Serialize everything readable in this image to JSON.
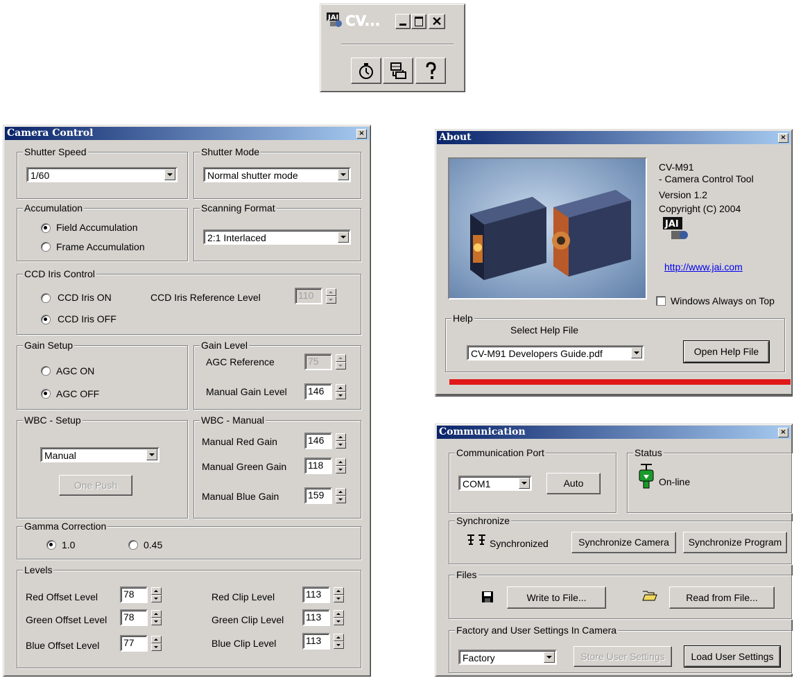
{
  "toolbar_window": {
    "title": "CV...",
    "buttons": [
      "minimize",
      "maximize",
      "close"
    ],
    "icons": [
      "stopwatch-icon",
      "network-icon",
      "help-icon"
    ]
  },
  "camera_control": {
    "title": "Camera Control",
    "close_glyph": "×",
    "shutter_speed": {
      "label": "Shutter Speed",
      "value": "1/60"
    },
    "shutter_mode": {
      "label": "Shutter Mode",
      "value": "Normal shutter mode"
    },
    "accumulation": {
      "label": "Accumulation",
      "options": [
        "Field Accumulation",
        "Frame Accumulation"
      ],
      "selected": 0
    },
    "scanning_format": {
      "label": "Scanning Format",
      "value": "2:1 Interlaced"
    },
    "ccd_iris": {
      "label": "CCD Iris Control",
      "options": [
        "CCD Iris ON",
        "CCD Iris OFF"
      ],
      "selected": 1,
      "ref_label": "CCD Iris Reference Level",
      "ref_value": "110"
    },
    "gain_setup": {
      "label": "Gain Setup",
      "options": [
        "AGC ON",
        "AGC OFF"
      ],
      "selected": 1
    },
    "gain_level": {
      "label": "Gain Level",
      "agc_ref_label": "AGC Reference",
      "agc_ref_value": "75",
      "manual_label": "Manual Gain Level",
      "manual_value": "146"
    },
    "wbc_setup": {
      "label": "WBC - Setup",
      "value": "Manual",
      "one_push": "One Push"
    },
    "wbc_manual": {
      "label": "WBC - Manual",
      "red_label": "Manual Red Gain",
      "red_value": "146",
      "green_label": "Manual Green Gain",
      "green_value": "118",
      "blue_label": "Manual Blue Gain",
      "blue_value": "159"
    },
    "gamma": {
      "label": "Gamma Correction",
      "options": [
        "1.0",
        "0.45"
      ],
      "selected": 0
    },
    "levels": {
      "label": "Levels",
      "red_offset_label": "Red Offset Level",
      "red_offset": "78",
      "green_offset_label": "Green Offset Level",
      "green_offset": "78",
      "blue_offset_label": "Blue Offset Level",
      "blue_offset": "77",
      "red_clip_label": "Red Clip Level",
      "red_clip": "113",
      "green_clip_label": "Green Clip Level",
      "green_clip": "113",
      "blue_clip_label": "Blue Clip Level",
      "blue_clip": "113"
    }
  },
  "about": {
    "title": "About",
    "close_glyph": "×",
    "product": "CV-M91",
    "subtitle": "- Camera Control Tool",
    "version": "Version 1.2",
    "copyright": "Copyright (C) 2004",
    "link": "http://www.jai.com",
    "always_on_top": "Windows Always on Top",
    "help": {
      "label": "Help",
      "select_label": "Select Help File",
      "value": "CV-M91 Developers Guide.pdf",
      "open_button": "Open Help File"
    }
  },
  "communication": {
    "title": "Communication",
    "close_glyph": "×",
    "port": {
      "label": "Communication Port",
      "value": "COM1",
      "auto": "Auto"
    },
    "status": {
      "label": "Status",
      "value": "On-line"
    },
    "sync": {
      "label": "Synchronize",
      "status": "Synchronized",
      "camera_btn": "Synchronize Camera",
      "program_btn": "Synchronize Program"
    },
    "files": {
      "label": "Files",
      "write": "Write to File...",
      "read": "Read from File..."
    },
    "settings": {
      "label": "Factory and User Settings In Camera",
      "value": "Factory",
      "store": "Store User Settings",
      "load": "Load User Settings"
    }
  },
  "colors": {
    "title_start": "#0a246a",
    "title_end": "#a6caf0",
    "face": "#d6d3ce",
    "progress": "#e01818"
  }
}
